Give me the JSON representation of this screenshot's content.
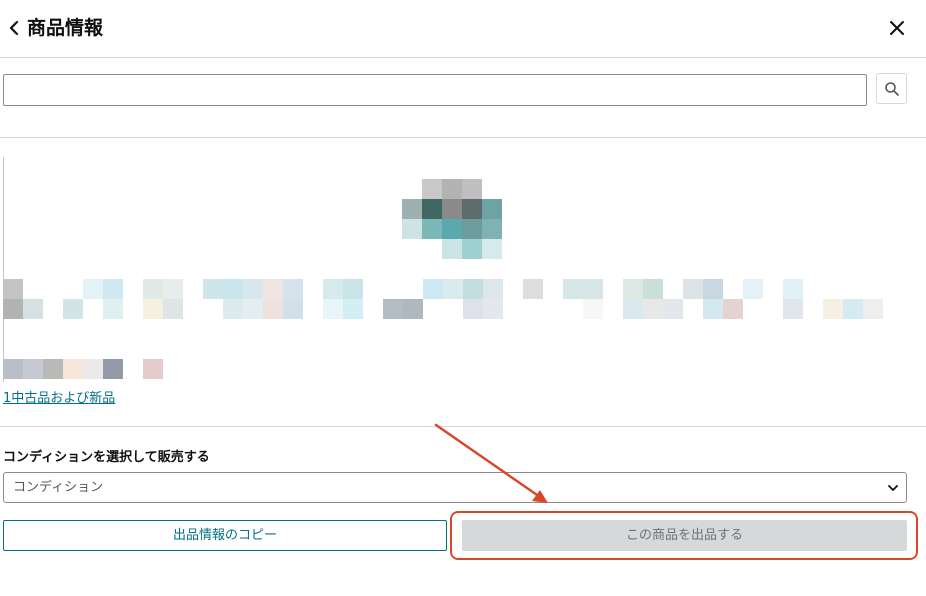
{
  "header": {
    "title": "商品情報",
    "back_icon": "chevron-left-icon",
    "close_icon": "close-icon"
  },
  "search": {
    "value": "",
    "placeholder": "",
    "button_icon": "search-icon"
  },
  "product": {
    "offers_link": "1中古品および新品"
  },
  "condition": {
    "label": "コンディションを選択して販売する",
    "selected": "コンディション",
    "chevron_icon": "chevron-down-icon"
  },
  "actions": {
    "copy_label": "出品情報のコピー",
    "list_label": "この商品を出品する"
  },
  "colors": {
    "link": "#007185",
    "annotation": "#d9472b",
    "disabled_button": "#d5d9d9"
  }
}
